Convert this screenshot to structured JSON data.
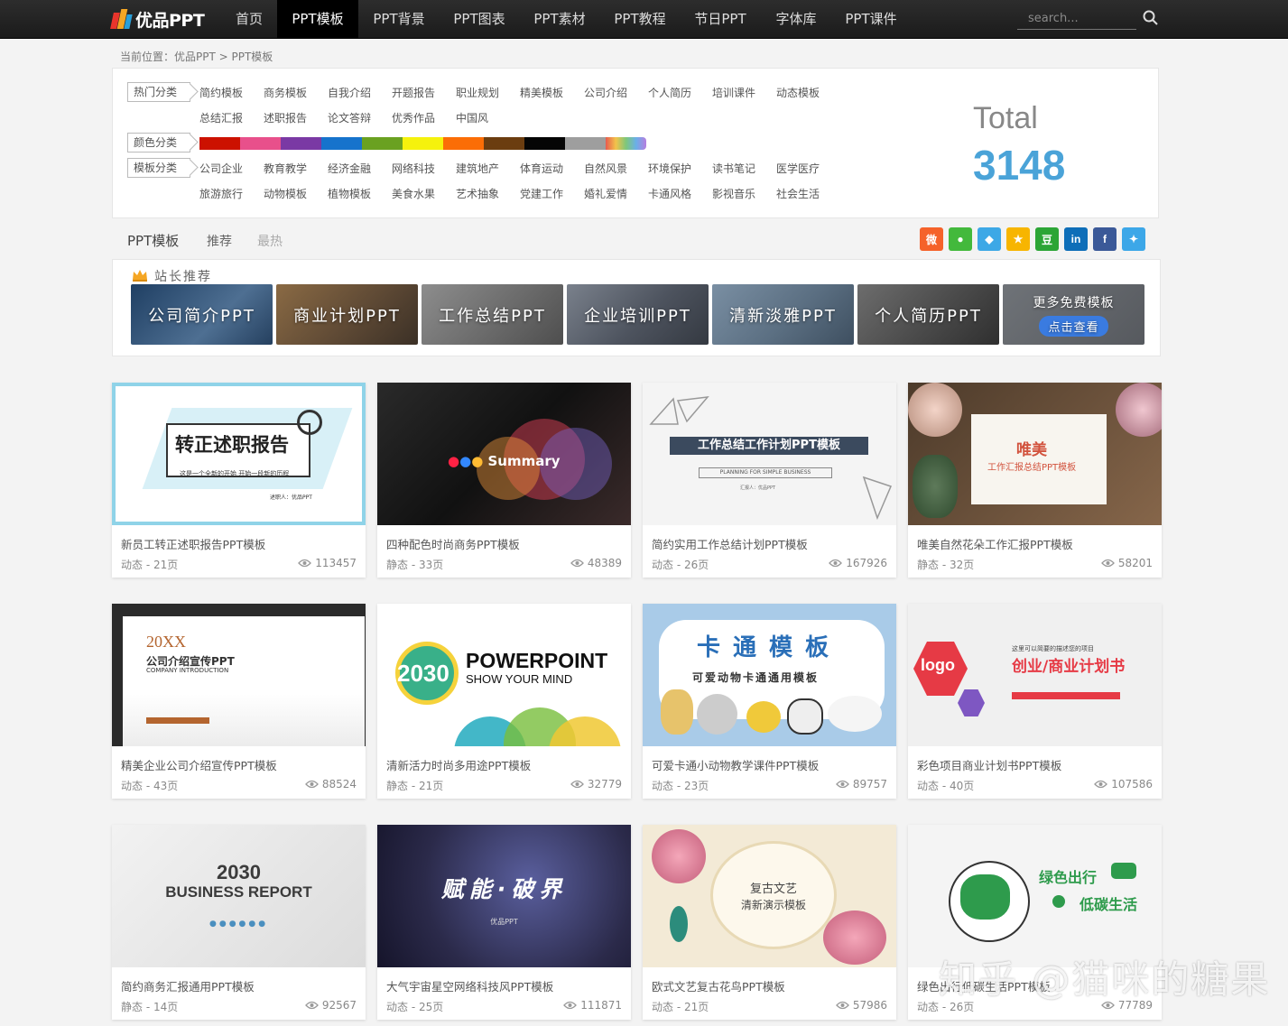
{
  "site": {
    "logo_text": "优品PPT"
  },
  "nav": [
    {
      "label": "首页"
    },
    {
      "label": "PPT模板"
    },
    {
      "label": "PPT背景"
    },
    {
      "label": "PPT图表"
    },
    {
      "label": "PPT素材"
    },
    {
      "label": "PPT教程"
    },
    {
      "label": "节日PPT"
    },
    {
      "label": "字体库"
    },
    {
      "label": "PPT课件"
    }
  ],
  "search": {
    "placeholder": "search..."
  },
  "breadcrumb": "当前位置：优品PPT > PPT模板",
  "filters": {
    "hot_label": "热门分类",
    "hot": [
      "简约模板",
      "商务模板",
      "自我介绍",
      "开题报告",
      "职业规划",
      "精美模板",
      "公司介绍",
      "个人简历",
      "培训课件",
      "动态模板",
      "总结汇报",
      "述职报告",
      "论文答辩",
      "优秀作品",
      "中国风"
    ],
    "color_label": "颜色分类",
    "colors": [
      "#cc1100",
      "#e8508b",
      "#7a39a4",
      "#1673cc",
      "#6aa121",
      "#f5f20d",
      "#fb6d06",
      "#6b3d10",
      "#050505",
      "#9e9e9e",
      "rainbow"
    ],
    "template_label": "模板分类",
    "templates": [
      "公司企业",
      "教育教学",
      "经济金融",
      "网络科技",
      "建筑地产",
      "体育运动",
      "自然风景",
      "环境保护",
      "读书笔记",
      "医学医疗",
      "旅游旅行",
      "动物模板",
      "植物模板",
      "美食水果",
      "艺术抽象",
      "党建工作",
      "婚礼爱情",
      "卡通风格",
      "影视音乐",
      "社会生活"
    ]
  },
  "total": {
    "label": "Total",
    "count": "3148"
  },
  "tabs": [
    "PPT模板",
    "推荐",
    "最热"
  ],
  "share": [
    {
      "name": "weibo-icon",
      "color": "#f5622a"
    },
    {
      "name": "wechat-icon",
      "color": "#43b93c"
    },
    {
      "name": "qq-icon",
      "color": "#3da8e6"
    },
    {
      "name": "qzone-icon",
      "color": "#f7b500"
    },
    {
      "name": "douban-icon",
      "color": "#2ca536",
      "text": "豆"
    },
    {
      "name": "linkedin-icon",
      "color": "#0e6eb8",
      "text": "in"
    },
    {
      "name": "facebook-icon",
      "color": "#3b5998",
      "text": "f"
    },
    {
      "name": "twitter-icon",
      "color": "#3ca7e8"
    }
  ],
  "recommend": {
    "title": "站长推荐",
    "banners": [
      "公司简介PPT",
      "商业计划PPT",
      "工作总结PPT",
      "企业培训PPT",
      "清新淡雅PPT",
      "个人简历PPT"
    ],
    "more": {
      "label": "更多免费模板",
      "button": "点击查看"
    }
  },
  "cards": [
    {
      "title": "新员工转正述职报告PPT模板",
      "meta": "动态 - 21页",
      "views": "113457",
      "thumb_text": "转正述职报告",
      "thumb_sub": "这是一个全新的开始 开始一段新的历程",
      "thumb_sign": "述职人：优品PPT"
    },
    {
      "title": "四种配色时尚商务PPT模板",
      "meta": "静态 - 33页",
      "views": "48389",
      "thumb_text": "Summary"
    },
    {
      "title": "简约实用工作总结计划PPT模板",
      "meta": "动态 - 26页",
      "views": "167926",
      "thumb_text": "工作总结工作计划PPT模板",
      "thumb_sub": "PLANNING FOR SIMPLE BUSINESS",
      "thumb_sign": "汇报人：优品PPT"
    },
    {
      "title": "唯美自然花朵工作汇报PPT模板",
      "meta": "静态 - 32页",
      "views": "58201",
      "thumb_text": "唯美",
      "thumb_sub": "工作汇报总结PPT模板"
    },
    {
      "title": "精美企业公司介绍宣传PPT模板",
      "meta": "动态 - 43页",
      "views": "88524",
      "thumb_text": "20XX",
      "thumb_sub": "公司介绍宣传PPT",
      "thumb_sign": "COMPANY INTRODUCTION"
    },
    {
      "title": "清新活力时尚多用途PPT模板",
      "meta": "静态 - 21页",
      "views": "32779",
      "thumb_text": "2030",
      "thumb_sub": "POWERPOINT",
      "thumb_sign": "SHOW YOUR MIND"
    },
    {
      "title": "可爱卡通小动物教学课件PPT模板",
      "meta": "动态 - 23页",
      "views": "89757",
      "thumb_text": "卡通模板",
      "thumb_sub": "可爱动物卡通通用模板"
    },
    {
      "title": "彩色项目商业计划书PPT模板",
      "meta": "动态 - 40页",
      "views": "107586",
      "thumb_text": "logo",
      "thumb_sub": "创业/商业计划书",
      "thumb_sign": "这里可以简要的描述您的项目"
    },
    {
      "title": "简约商务汇报通用PPT模板",
      "meta": "静态 - 14页",
      "views": "92567",
      "thumb_text": "2030",
      "thumb_sub": "BUSINESS REPORT"
    },
    {
      "title": "大气宇宙星空网络科技风PPT模板",
      "meta": "动态 - 25页",
      "views": "111871",
      "thumb_text": "赋能·破界",
      "thumb_sub": "优品PPT"
    },
    {
      "title": "欧式文艺复古花鸟PPT模板",
      "meta": "动态 - 21页",
      "views": "57986",
      "thumb_text": "复古文艺",
      "thumb_sub": "清新演示模板"
    },
    {
      "title": "绿色出行低碳生活PPT模板",
      "meta": "动态 - 26页",
      "views": "77789",
      "thumb_text": "绿色出行",
      "thumb_sub": "低碳生活"
    }
  ],
  "watermark": "知乎 @猫咪的糖果"
}
